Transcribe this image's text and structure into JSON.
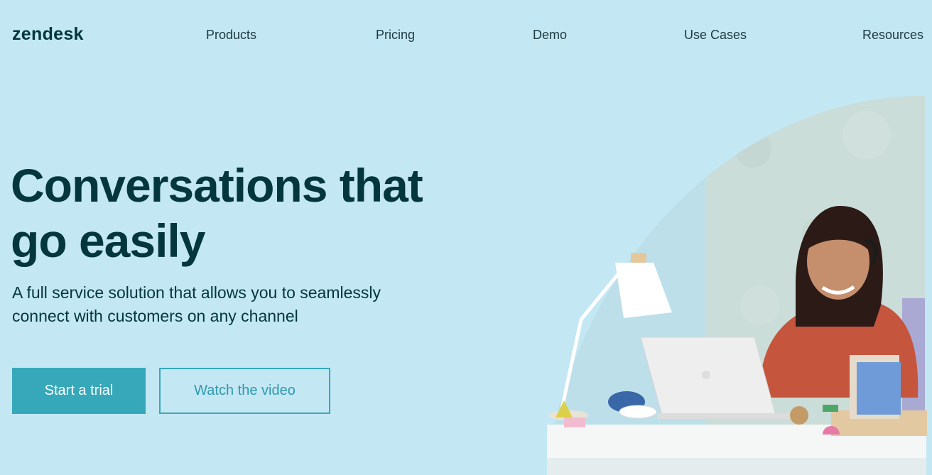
{
  "brand": {
    "logo_text": "zendesk"
  },
  "nav": {
    "items": [
      {
        "label": "Products"
      },
      {
        "label": "Pricing"
      },
      {
        "label": "Demo"
      },
      {
        "label": "Use Cases"
      },
      {
        "label": "Resources"
      }
    ]
  },
  "hero": {
    "title": "Conversations that go easily",
    "subtitle": "A full service solution that allows you to seamlessly connect with customers on any channel",
    "primary_cta": "Start a trial",
    "secondary_cta": "Watch the video"
  },
  "colors": {
    "background": "#c3e7f3",
    "text": "#03363d",
    "accent": "#37a8ba"
  }
}
